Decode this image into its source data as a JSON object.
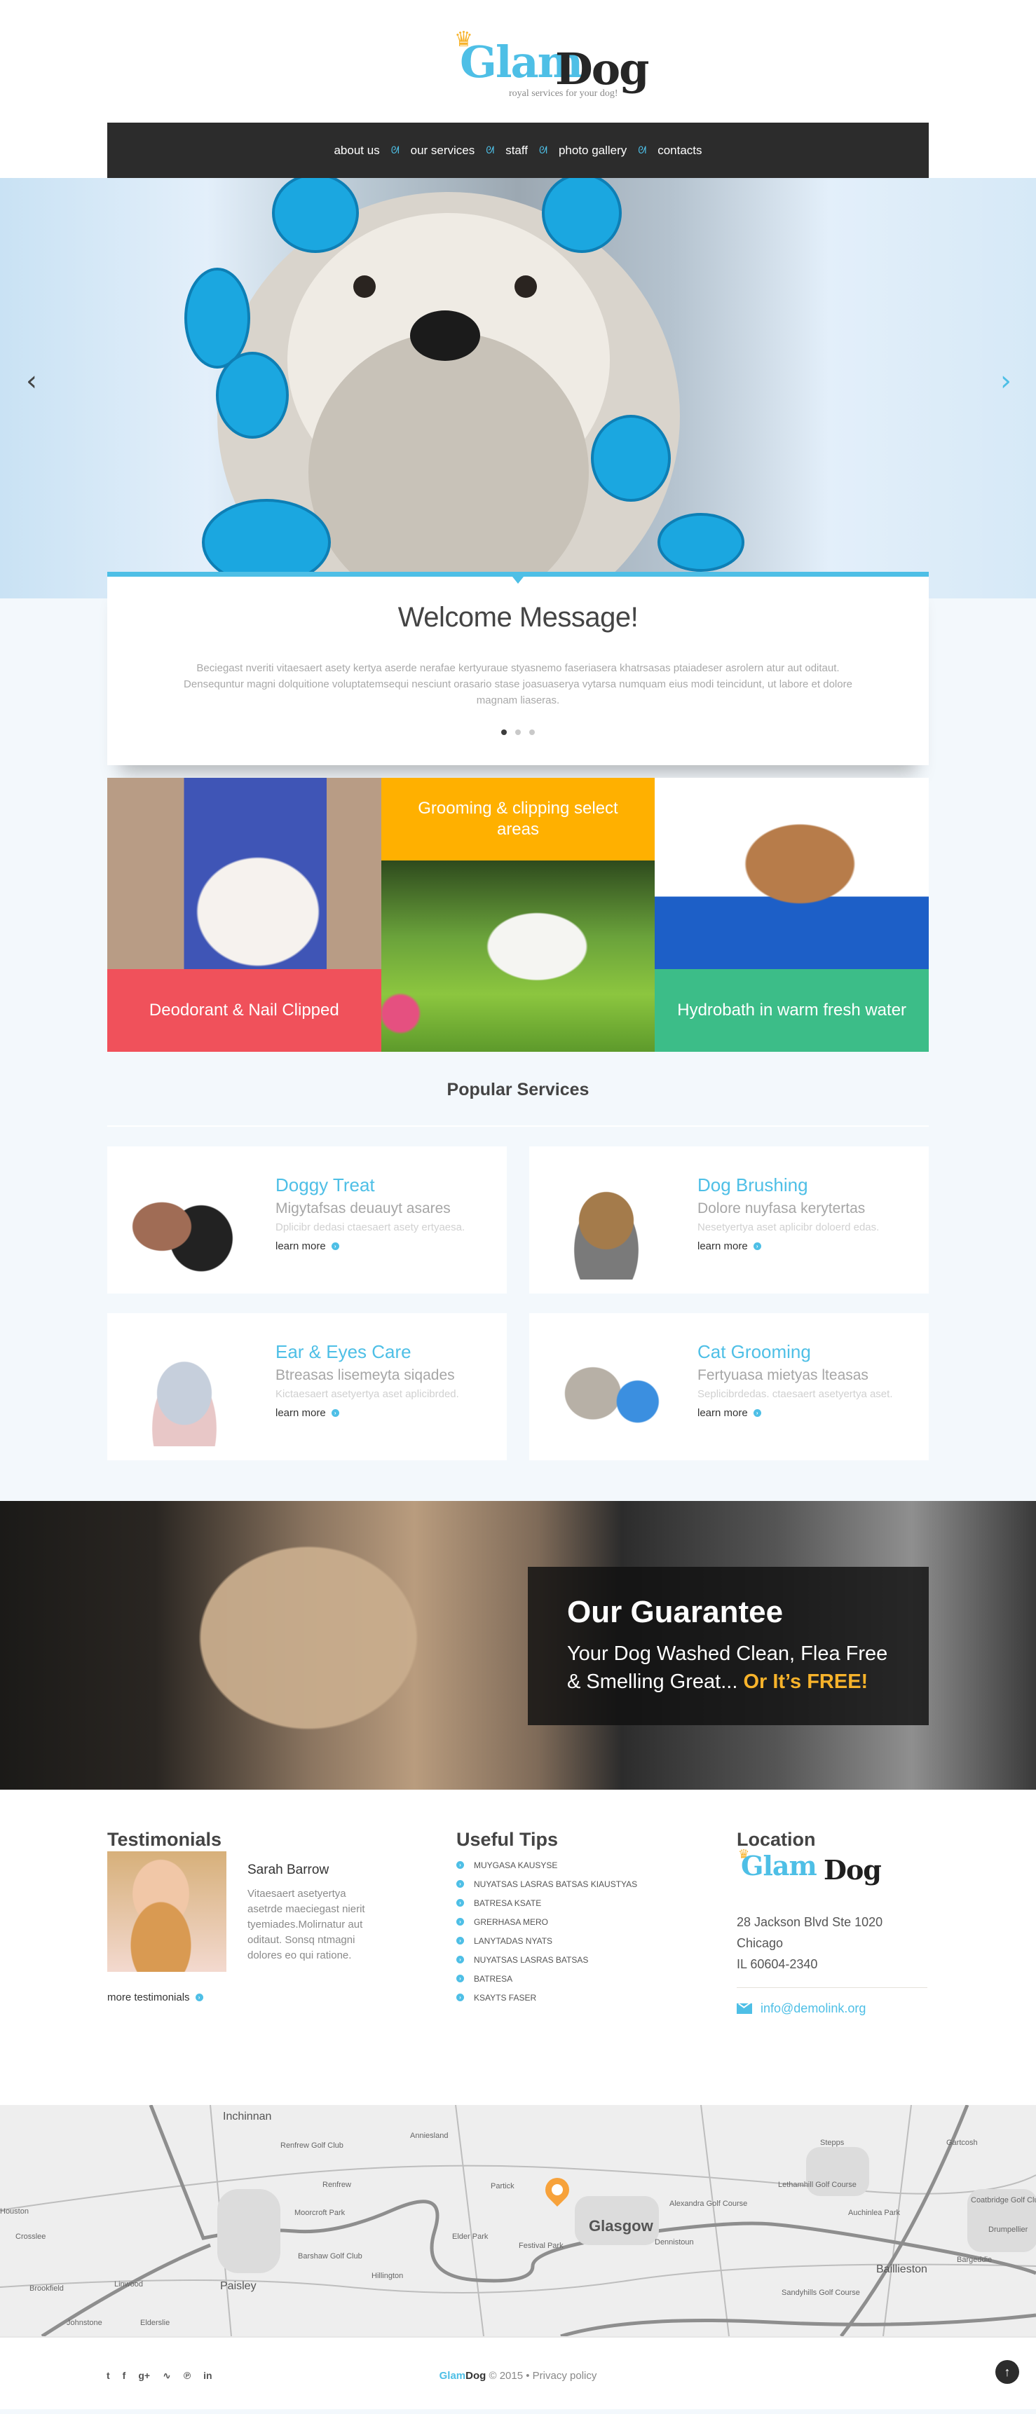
{
  "brand": {
    "glam": "Glam",
    "dog": "Dog",
    "tagline": "royal services for your dog!",
    "crown_icon": "♛",
    "accent_color": "#4ebfe6",
    "dark_color": "#2c2c2c"
  },
  "nav": {
    "items": [
      "about us",
      "our services",
      "staff",
      "photo gallery",
      "contacts"
    ],
    "separator_icon": "bow-icon",
    "separator_glyph": "ᘛ"
  },
  "hero": {
    "prev_glyph": "‹",
    "next_glyph": "›"
  },
  "welcome": {
    "title": "Welcome Message!",
    "text": "Beciegast nveriti vitaesaert asety kertya aserde nerafae kertyuraue styasnemo faseriasera khatrsasas ptaiadeser asrolern atur aut oditaut. Densequntur magni dolquitione voluptatemsequi nesciunt orasario stase joasuaserya vytarsa numquam eius modi teincidunt, ut labore et dolore magnam liaseras.",
    "slides": 3,
    "active_slide": 1
  },
  "tiles": [
    {
      "label": "Deodorant & Nail Clipped",
      "color": "#f0515b"
    },
    {
      "label": "Grooming & clipping select areas",
      "color": "#ffb000"
    },
    {
      "label": "Hydrobath in warm fresh water",
      "color": "#3cbd88"
    }
  ],
  "popular": {
    "title": "Popular Services",
    "learn_more": "learn more",
    "items": [
      {
        "title": "Doggy Treat",
        "subtitle": "Migytafsas deuauyt asares",
        "desc": "Dplicibr dedasi ctaesaert asety ertyaesa."
      },
      {
        "title": "Dog Brushing",
        "subtitle": "Dolore nuyfasa kerytertas",
        "desc": "Nesetyertya aset aplicibr doloerd edas."
      },
      {
        "title": "Ear & Eyes Care",
        "subtitle": "Btreasas lisemeyta siqades",
        "desc": "Kictaesaert asetyertya aset aplicibrded."
      },
      {
        "title": "Cat Grooming",
        "subtitle": "Fertyuasa mietyas lteasas",
        "desc": "Seplicibrdedas. ctaesaert asetyertya aset."
      }
    ]
  },
  "guarantee": {
    "title": "Our Guarantee",
    "line": "Your Dog Washed Clean, Flea Free & Smelling Great...",
    "highlight": "Or It’s FREE!",
    "highlight_color": "#f7b32b"
  },
  "testimonials": {
    "title": "Testimonials",
    "name": "Sarah Barrow",
    "text": "Vitaesaert asetyertya asetrde maeciegast nierit tyemiades.Molirnatur aut oditaut. Sonsq ntmagni dolores eo qui ratione.",
    "more": "more testimonials"
  },
  "tips": {
    "title": "Useful Tips",
    "items": [
      "MUYGASA KAUSYSE",
      "NUYATSAS LASRAS BATSAS KIAUSTYAS",
      "BATRESA KSATE",
      "GRERHASA MERO",
      "LANYTADAS NYATS",
      "NUYATSAS LASRAS BATSAS",
      "BATRESA",
      "KSAYTS FASER"
    ]
  },
  "location": {
    "title": "Location",
    "address": [
      "28 Jackson Blvd Ste 1020",
      "Chicago",
      "IL 60604-2340"
    ],
    "email": "info@demolink.org"
  },
  "map": {
    "labels": [
      {
        "text": "Inchinnan"
      },
      {
        "text": "Renfrew Golf Club"
      },
      {
        "text": "Renfrew"
      },
      {
        "text": "Moorcroft Park"
      },
      {
        "text": "Barshaw Golf Club"
      },
      {
        "text": "Hillington"
      },
      {
        "text": "Paisley"
      },
      {
        "text": "Johnstone"
      },
      {
        "text": "Elderslie"
      },
      {
        "text": "Linwood"
      },
      {
        "text": "Brookfield"
      },
      {
        "text": "Crosslee"
      },
      {
        "text": "Houston"
      },
      {
        "text": "Anniesland"
      },
      {
        "text": "Partick"
      },
      {
        "text": "Elder Park"
      },
      {
        "text": "Glasgow"
      },
      {
        "text": "Dennistoun"
      },
      {
        "text": "Festival Park"
      },
      {
        "text": "Alexandra Golf Course"
      },
      {
        "text": "Lethamhill Golf Course"
      },
      {
        "text": "Stepps"
      },
      {
        "text": "Gartcosh"
      },
      {
        "text": "Auchinlea Park"
      },
      {
        "text": "Coatbridge Golf Club"
      },
      {
        "text": "Drumpellier"
      },
      {
        "text": "Bargeddie"
      },
      {
        "text": "Baillieston"
      },
      {
        "text": "Sandyhills Golf Course"
      }
    ]
  },
  "footer": {
    "social": [
      {
        "name": "twitter-icon",
        "glyph": "t"
      },
      {
        "name": "facebook-icon",
        "glyph": "f"
      },
      {
        "name": "google-plus-icon",
        "glyph": "g+"
      },
      {
        "name": "rss-icon",
        "glyph": "∿"
      },
      {
        "name": "pinterest-icon",
        "glyph": "℗"
      },
      {
        "name": "linkedin-icon",
        "glyph": "in"
      }
    ],
    "copy_brand_glam": "Glam",
    "copy_brand_dog": "Dog",
    "copyright": "© 2015 •",
    "privacy": "Privacy policy",
    "to_top_glyph": "↑"
  }
}
